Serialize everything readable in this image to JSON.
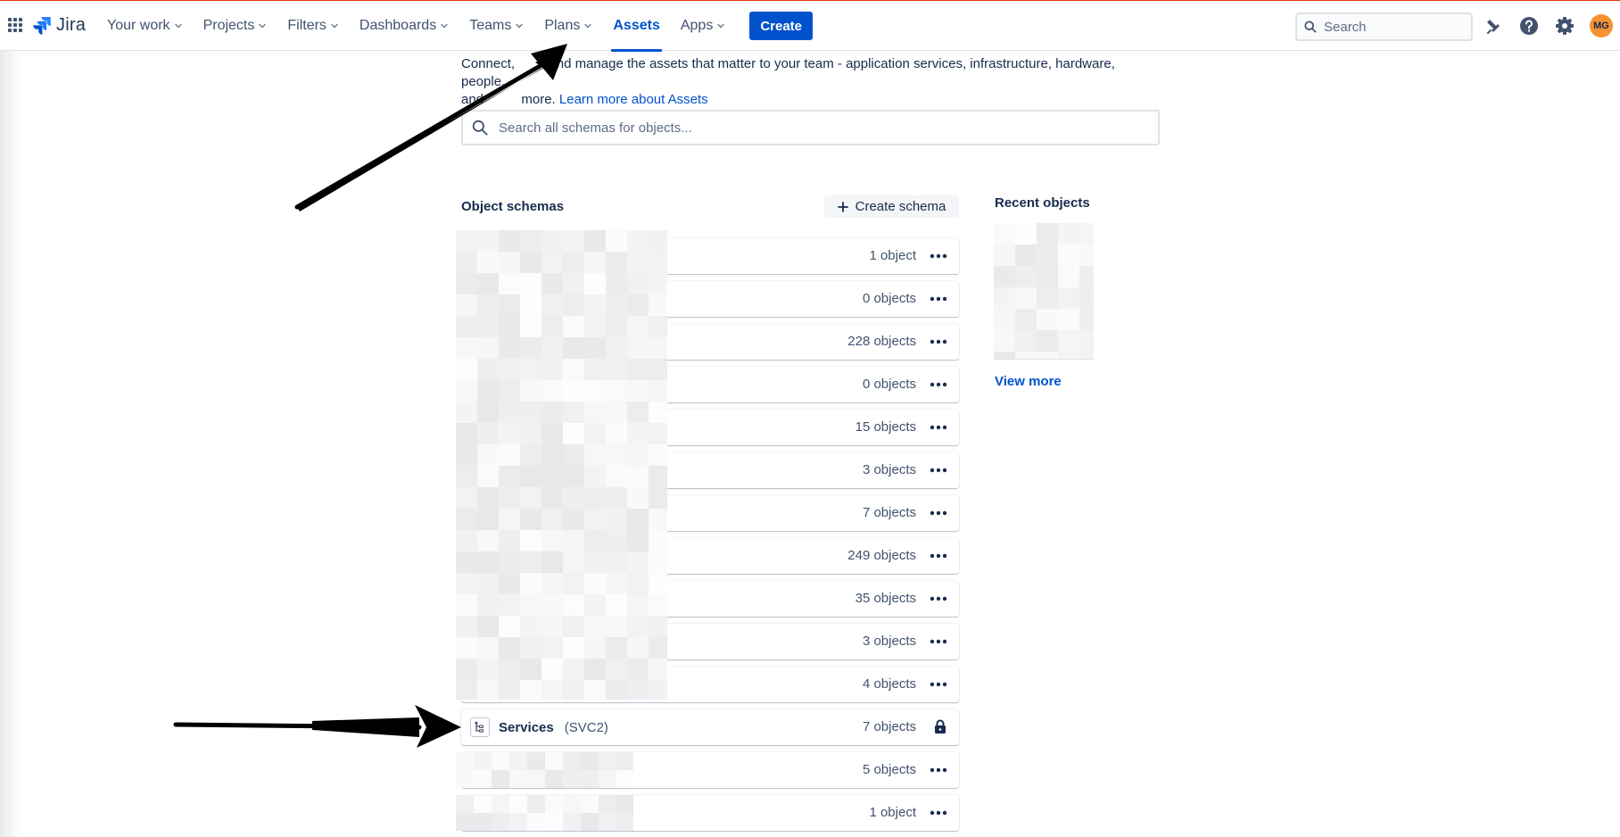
{
  "nav": {
    "logo_text": "Jira",
    "items": [
      {
        "label": "Your work",
        "dropdown": true,
        "active": false
      },
      {
        "label": "Projects",
        "dropdown": true,
        "active": false
      },
      {
        "label": "Filters",
        "dropdown": true,
        "active": false
      },
      {
        "label": "Dashboards",
        "dropdown": true,
        "active": false
      },
      {
        "label": "Teams",
        "dropdown": true,
        "active": false
      },
      {
        "label": "Plans",
        "dropdown": true,
        "active": false
      },
      {
        "label": "Assets",
        "dropdown": false,
        "active": true
      },
      {
        "label": "Apps",
        "dropdown": true,
        "active": false
      }
    ],
    "create_label": "Create",
    "search_placeholder": "Search",
    "avatar_initials": "MG",
    "icons": [
      "notifications-icon",
      "help-icon",
      "settings-icon"
    ]
  },
  "intro": {
    "text_a": "Connect,",
    "text_b": "and manage the assets that matter to your team - application services, infrastructure, hardware, people,",
    "text_c": "and",
    "text_d": "more.",
    "link": "Learn more about Assets"
  },
  "main_search": {
    "placeholder": "Search all schemas for objects..."
  },
  "schemas": {
    "title": "Object schemas",
    "create_label": "Create schema",
    "rows": [
      {
        "count": "1 object",
        "redacted": true
      },
      {
        "count": "0 objects",
        "redacted": true
      },
      {
        "count": "228 objects",
        "redacted": true
      },
      {
        "count": "0 objects",
        "redacted": true
      },
      {
        "count": "15 objects",
        "redacted": true
      },
      {
        "count": "3 objects",
        "redacted": true
      },
      {
        "count": "7 objects",
        "redacted": true
      },
      {
        "count": "249 objects",
        "redacted": true
      },
      {
        "count": "35 objects",
        "redacted": true
      },
      {
        "count": "3 objects",
        "redacted": true
      },
      {
        "count": "4 objects",
        "redacted": true
      },
      {
        "name": "Services",
        "key": "(SVC2)",
        "count": "7 objects",
        "locked": true,
        "redacted": false
      },
      {
        "count": "5 objects",
        "redacted": true
      },
      {
        "count": "1 object",
        "redacted": true
      }
    ]
  },
  "recent": {
    "title": "Recent objects",
    "view_more": "View more"
  },
  "colors": {
    "brand": "#0052cc",
    "text": "#172b4d",
    "subtle": "#42526e",
    "avatar": "#f79232"
  }
}
